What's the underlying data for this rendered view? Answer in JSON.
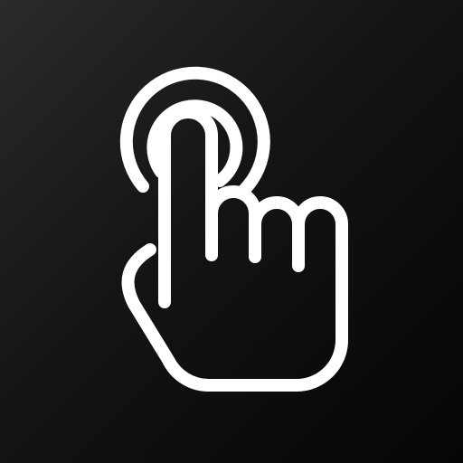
{
  "app_icon": {
    "icon": "tap-gesture-icon",
    "background_colors": [
      "#2a2a2a",
      "#141414",
      "#050505"
    ],
    "stroke_color": "#ffffff"
  }
}
